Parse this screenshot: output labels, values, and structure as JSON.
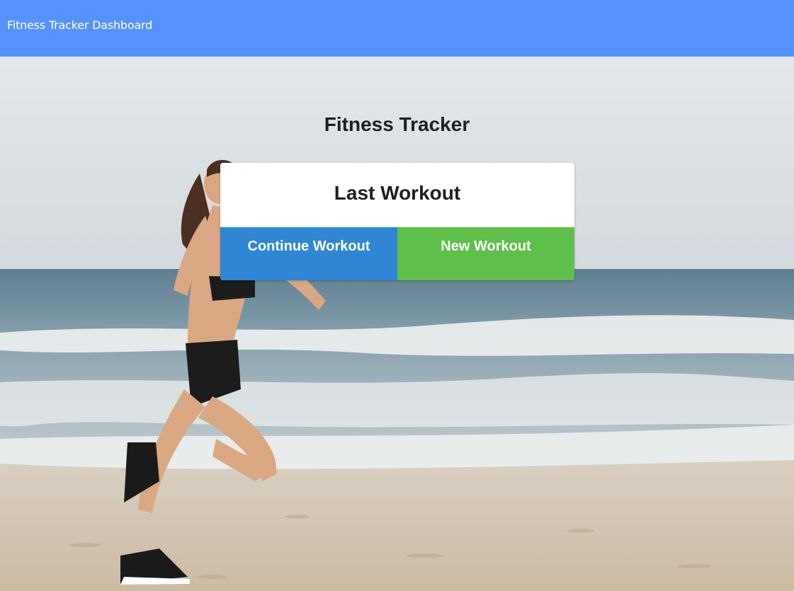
{
  "navbar": {
    "brand": "Fitness Tracker Dashboard",
    "background": "#5592fb"
  },
  "hero": {
    "image": "beach-runner-photo",
    "title": "Fitness Tracker"
  },
  "card": {
    "title": "Last Workout",
    "actions": {
      "continue_label": "Continue Workout",
      "continue_color": "#2e86d4",
      "new_label": "New Workout",
      "new_color": "#5fbf4b"
    }
  }
}
